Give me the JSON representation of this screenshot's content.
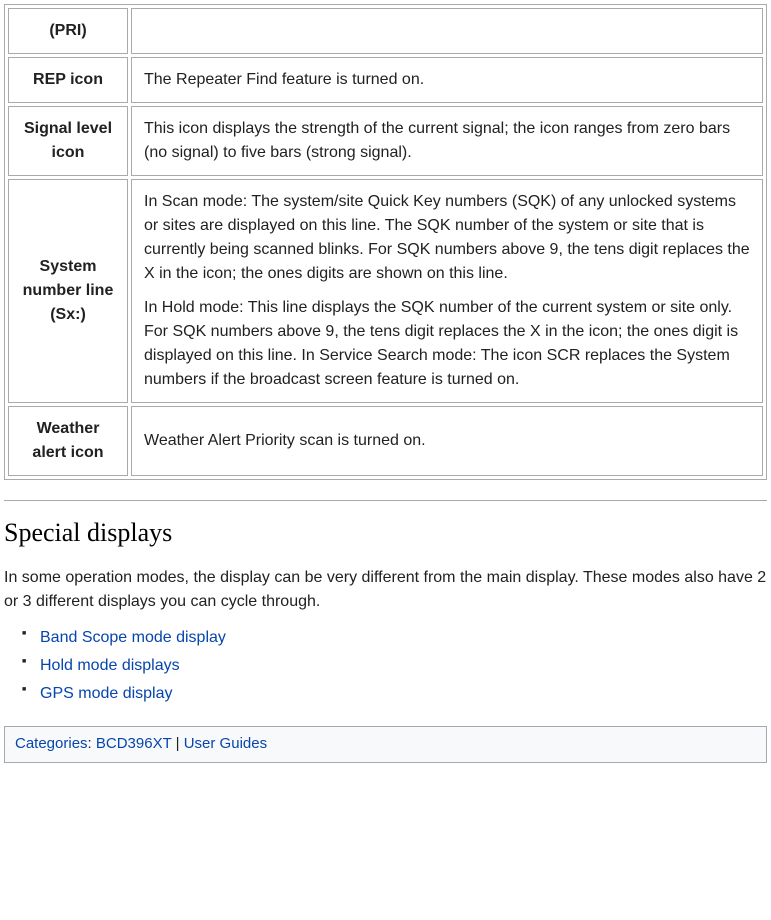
{
  "table": {
    "rows": [
      {
        "header": "(PRI)",
        "cells": [
          ""
        ]
      },
      {
        "header": "REP icon",
        "cells": [
          "The Repeater Find feature is turned on."
        ]
      },
      {
        "header": "Signal level icon",
        "cells": [
          "This icon displays the strength of the current signal; the icon ranges from zero bars (no signal) to five bars (strong signal)."
        ]
      },
      {
        "header": "System number line (Sx:)",
        "cells": [
          "In Scan mode: The system/site Quick Key numbers (SQK) of any unlocked systems or sites are displayed on this line. The SQK number of the system or site that is currently being scanned blinks. For SQK numbers above 9, the tens digit replaces the X in the icon; the ones digits are shown on this line.",
          "In Hold mode: This line displays the SQK number of the current system or site only. For SQK numbers above 9, the tens digit replaces the X in the icon; the ones digit is displayed on this line. In Service Search mode: The icon SCR replaces the System numbers if the broadcast screen feature is turned on."
        ]
      },
      {
        "header": "Weather alert icon",
        "cells": [
          "Weather Alert Priority scan is turned on."
        ]
      }
    ]
  },
  "section": {
    "heading": "Special displays",
    "intro": "In some operation modes, the display can be very different from the main display. These modes also have 2 or 3 different displays you can cycle through.",
    "links": [
      "Band Scope mode display",
      "Hold mode displays",
      "GPS mode display"
    ]
  },
  "catlinks": {
    "label": "Categories",
    "sep1": ": ",
    "cat1": "BCD396XT",
    "sep2": " | ",
    "cat2": "User Guides"
  }
}
